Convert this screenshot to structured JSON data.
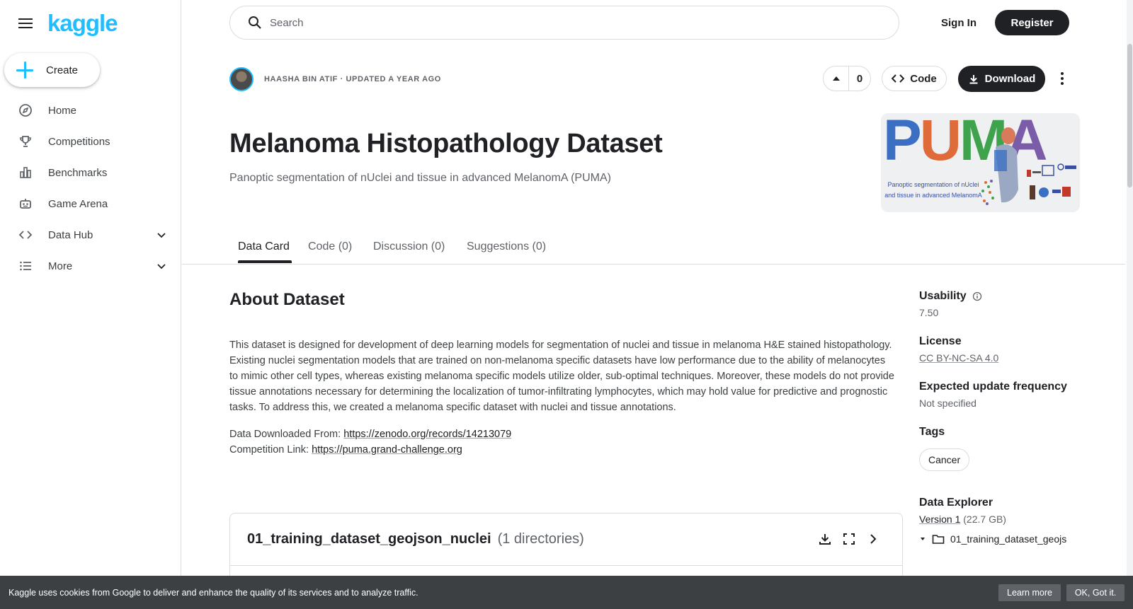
{
  "brand": {
    "logo_text": "kaggle",
    "accent": "#20beff"
  },
  "sidebar": {
    "create_label": "Create",
    "items": [
      {
        "label": "Home",
        "icon": "compass-icon"
      },
      {
        "label": "Competitions",
        "icon": "trophy-icon"
      },
      {
        "label": "Benchmarks",
        "icon": "bar-chart-icon"
      },
      {
        "label": "Game Arena",
        "icon": "robot-icon"
      },
      {
        "label": "Data Hub",
        "icon": "code-icon",
        "expandable": true
      },
      {
        "label": "More",
        "icon": "list-icon",
        "expandable": true
      }
    ]
  },
  "header": {
    "search_placeholder": "Search",
    "signin_label": "Sign In",
    "register_label": "Register"
  },
  "dataset": {
    "byline": "HAASHA BIN ATIF · UPDATED A YEAR AGO",
    "vote_count": "0",
    "code_label": "Code",
    "download_label": "Download",
    "title": "Melanoma Histopathology Dataset",
    "subtitle": "Panoptic segmentation of nUclei and tissue in advanced MelanomA (PUMA)",
    "thumbnail": {
      "letters": [
        "P",
        "U",
        "M",
        "A"
      ],
      "caption": "Panoptic segmentation of nUclei and tissue in advanced MelanomA"
    }
  },
  "tabs": [
    {
      "label": "Data Card",
      "active": true
    },
    {
      "label": "Code (0)"
    },
    {
      "label": "Discussion (0)"
    },
    {
      "label": "Suggestions (0)"
    }
  ],
  "about": {
    "heading": "About Dataset",
    "body": "This dataset is designed for development of deep learning models for segmentation of nuclei and tissue in melanoma H&E stained histopathology. Existing nuclei segmentation models that are trained on non-melanoma specific datasets have low performance due to the ability of melanocytes to mimic other cell types, whereas existing melanoma specific models utilize older, sub-optimal techniques. Moreover, these models do not provide tissue annotations necessary for determining the localization of tumor-infiltrating lymphocytes, which may hold value for predictive and prognostic tasks. To address this, we created a melanoma specific dataset with nuclei and tissue annotations.",
    "downloaded_label": "Data Downloaded From:",
    "downloaded_url": "https://zenodo.org/records/14213079",
    "competition_label": "Competition Link:",
    "competition_url": "https://puma.grand-challenge.org"
  },
  "file_card": {
    "name": "01_training_dataset_geojson_nuclei",
    "count": "(1 directories)"
  },
  "rail": {
    "usability_label": "Usability",
    "usability_value": "7.50",
    "license_label": "License",
    "license_value": "CC BY-NC-SA 4.0",
    "frequency_label": "Expected update frequency",
    "frequency_value": "Not specified",
    "tags_label": "Tags",
    "tags": [
      "Cancer"
    ],
    "explorer_label": "Data Explorer",
    "version_label": "Version 1",
    "version_size": "(22.7 GB)",
    "explorer_item": "01_training_dataset_geojs"
  },
  "cookie": {
    "message": "Kaggle uses cookies from Google to deliver and enhance the quality of its services and to analyze traffic.",
    "learn_label": "Learn more",
    "ok_label": "OK, Got it."
  }
}
